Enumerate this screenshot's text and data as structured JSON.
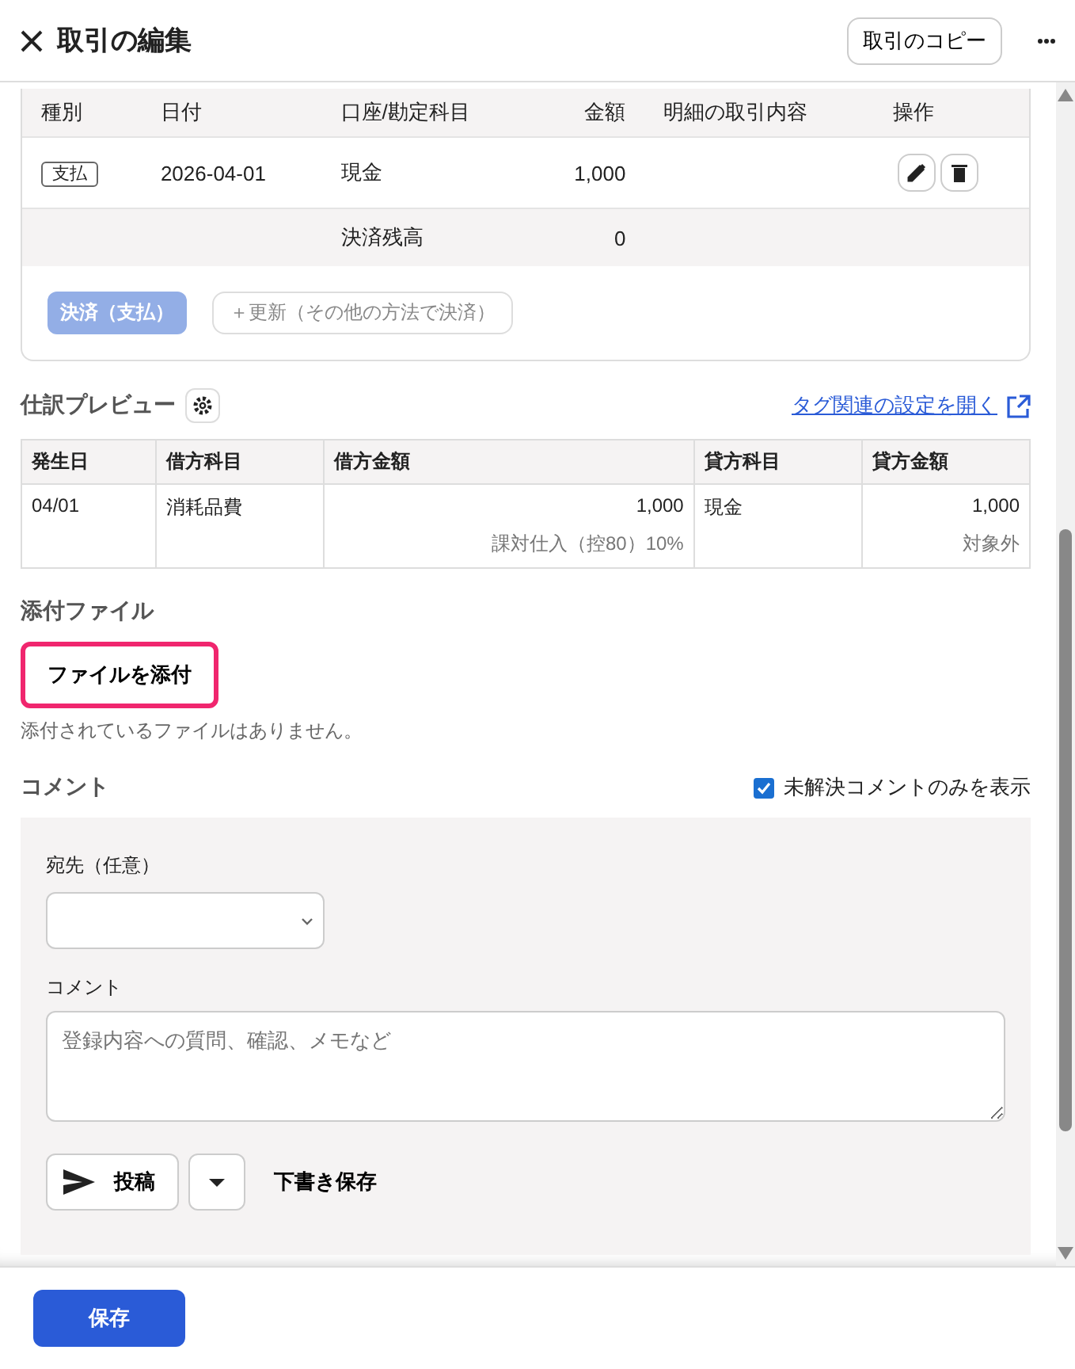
{
  "header": {
    "title": "取引の編集",
    "copy_button": "取引のコピー"
  },
  "settlement": {
    "columns": [
      "種別",
      "日付",
      "口座/勘定科目",
      "金額",
      "明細の取引内容",
      "操作"
    ],
    "rows": [
      {
        "type": "支払",
        "date": "2026-04-01",
        "account": "現金",
        "amount": "1,000"
      }
    ],
    "balance": {
      "label": "決済残高",
      "amount": "0"
    },
    "settle_button": {
      "label": "決済（支払）",
      "disabled": true
    },
    "update_button": "＋更新（その他の方法で決済）"
  },
  "journal": {
    "title": "仕訳プレビュー",
    "link": "タグ関連の設定を開く",
    "columns": [
      "発生日",
      "借方科目",
      "借方金額",
      "貸方科目",
      "貸方金額"
    ],
    "rows": [
      {
        "date": "04/01",
        "debit_account": "消耗品費",
        "debit_amount": "1,000",
        "debit_tax": "課対仕入（控80）10%",
        "credit_account": "現金",
        "credit_amount": "1,000",
        "credit_tax": "対象外"
      }
    ]
  },
  "attachments": {
    "title": "添付ファイル",
    "button": "ファイルを添付",
    "empty_text": "添付されているファイルはありません。"
  },
  "comments": {
    "title": "コメント",
    "filter": {
      "label": "未解決コメントのみを表示",
      "checked": true
    },
    "recipient_label": "宛先（任意）",
    "comment_label": "コメント",
    "placeholder": "登録内容への質問、確認、メモなど",
    "post_button": "投稿",
    "draft_button": "下書き保存"
  },
  "footer": {
    "save_button": "保存"
  }
}
